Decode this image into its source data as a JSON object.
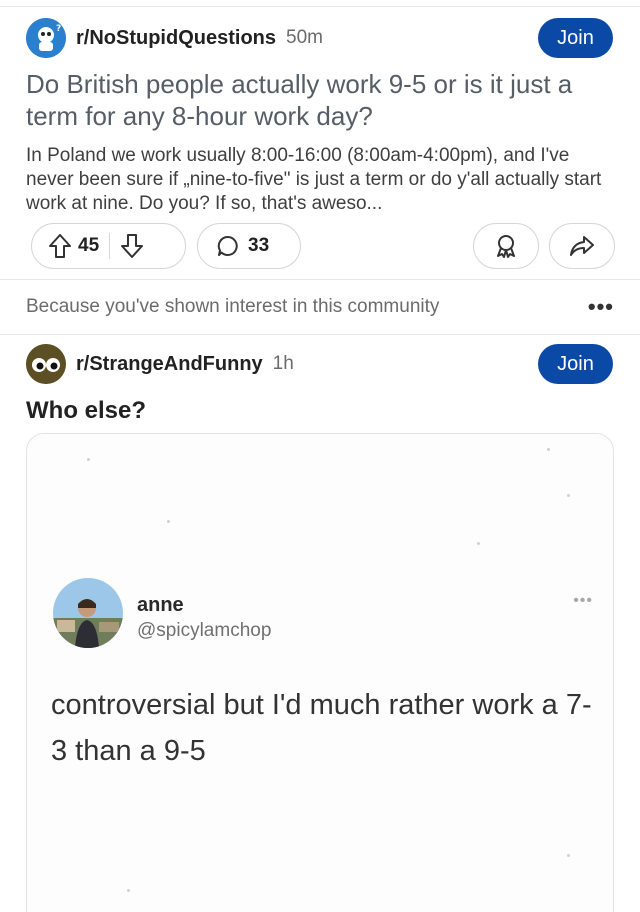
{
  "post1": {
    "subreddit": "r/NoStupidQuestions",
    "time": "50m",
    "join_label": "Join",
    "title": "Do British people actually work 9-5 or is it just a term for any 8-hour work day?",
    "body": "In Poland we work usually 8:00-16:00 (8:00am-4:00pm), and I've never been sure if „nine-to-five\" is just a term or do y'all actually start work at nine. Do you? If so, that's aweso...",
    "upvotes": "45",
    "comments": "33",
    "icons": [
      "upvote-arrow-icon",
      "downvote-arrow-icon",
      "comment-bubble-icon",
      "award-icon",
      "share-icon"
    ]
  },
  "recommendation": {
    "text": "Because you've shown interest in this community",
    "more_label": "•••"
  },
  "post2": {
    "subreddit": "r/StrangeAndFunny",
    "time": "1h",
    "join_label": "Join",
    "title": "Who else?",
    "tweet": {
      "name": "anne",
      "handle": "@spicylamchop",
      "more_label": "•••",
      "text": "controversial but I'd much rather work a 7-3 than a 9-5"
    }
  },
  "colors": {
    "join_button": "#0a4aa6",
    "title_text": "#555e66",
    "muted_text": "#6b6b6b"
  }
}
